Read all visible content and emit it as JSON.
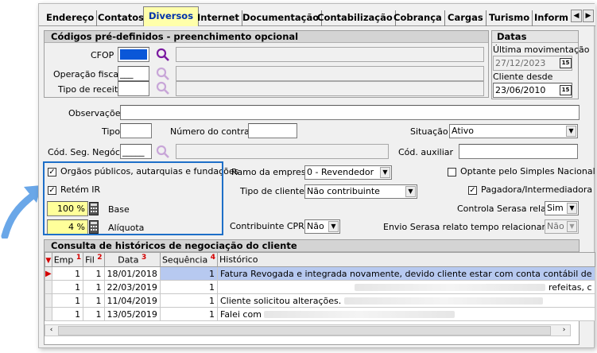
{
  "tabs": [
    "Endereço",
    "Contatos",
    "Diversos",
    "Internet",
    "Documentação",
    "Contabilização",
    "Cobrança",
    "Cargas",
    "Turismo",
    "Inform"
  ],
  "active_tab": "Diversos",
  "codes_panel": {
    "title": "Códigos pré-definidos - preenchimento opcional",
    "cfop_label": "CFOP",
    "operacao_label": "Operação fiscal",
    "operacao_value": "___",
    "receita_label": "Tipo de receita"
  },
  "dates_panel": {
    "title": "Datas",
    "ultima_label": "Última movimentação",
    "ultima_value": "27/12/2023",
    "desde_label": "Cliente desde",
    "desde_value": "23/06/2010",
    "cal_icon_text": "15"
  },
  "form": {
    "observacoes_label": "Observações",
    "tipo_label": "Tipo",
    "contrato_label": "Número do contrato",
    "situacao_label": "Situação",
    "situacao_value": "Ativo",
    "codseg_label": "Cód. Seg. Negócio",
    "codseg_value": "_____",
    "codaux_label": "Cód. auxiliar",
    "orgaos_label": "Orgãos públicos, autarquias e fundações",
    "retem_label": "Retém IR",
    "base_value": "100 %",
    "base_label": "Base",
    "aliquota_value": "4 %",
    "aliquota_label": "Alíquota",
    "ramo_label": "Ramo da empresa",
    "ramo_value": "0 - Revendedor",
    "tipo_cliente_label": "Tipo de cliente",
    "tipo_cliente_value": "Não contribuinte",
    "cprb_label": "Contribuinte CPRB",
    "cprb_value": "Não",
    "optante_label": "Optante pelo Simples Nacional",
    "pagadora_label": "Pagadora/Intermediadora",
    "serasa_label": "Controla Serasa relato",
    "serasa_value": "Sim",
    "envio_label": "Envio Serasa relato tempo relacionamento",
    "envio_value": "Não"
  },
  "history": {
    "title": "Consulta de históricos de negociação do cliente",
    "columns": [
      {
        "label": "Emp",
        "sort": "1"
      },
      {
        "label": "Fil",
        "sort": "2"
      },
      {
        "label": "Data",
        "sort": "3"
      },
      {
        "label": "Sequência",
        "sort": "4"
      },
      {
        "label": "Histórico",
        "sort": ""
      }
    ],
    "rows": [
      {
        "emp": "1",
        "fil": "1",
        "data": "18/01/2018",
        "seq": "1",
        "hist": "Fatura Revogada e integrada novamente, devido cliente estar com conta contábil de"
      },
      {
        "emp": "1",
        "fil": "1",
        "data": "22/03/2019",
        "seq": "1",
        "hist": "refeitas, c"
      },
      {
        "emp": "1",
        "fil": "1",
        "data": "11/04/2019",
        "seq": "1",
        "hist": "Cliente solicitou alterações."
      },
      {
        "emp": "1",
        "fil": "1",
        "data": "13/05/2019",
        "seq": "1",
        "hist": "Falei com"
      }
    ]
  },
  "colors": {
    "accent_blue": "#1e6fc8",
    "active_tab": "#ffffaa",
    "selected_row": "#b7c9f0",
    "yellow_field": "#ffff9a"
  }
}
